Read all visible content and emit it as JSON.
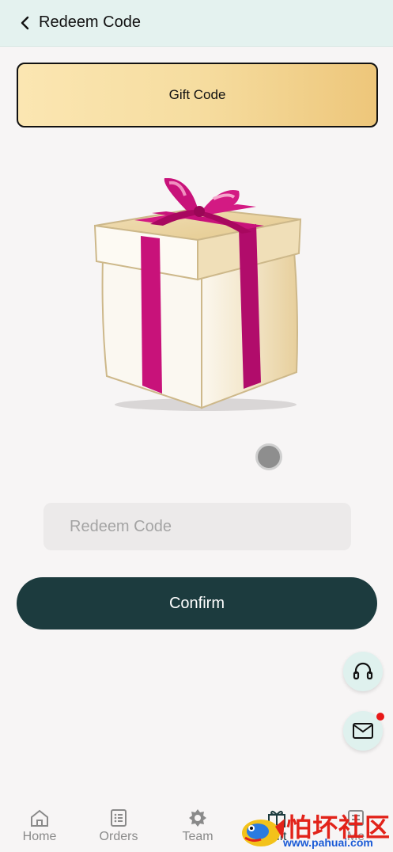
{
  "header": {
    "title": "Redeem Code"
  },
  "gift_tab": {
    "label": "Gift Code"
  },
  "redeem": {
    "placeholder": "Redeem Code",
    "confirm_label": "Confirm"
  },
  "tabbar": {
    "items": [
      {
        "label": "Home",
        "icon": "home-icon"
      },
      {
        "label": "Orders",
        "icon": "orders-icon"
      },
      {
        "label": "Team",
        "icon": "team-icon"
      },
      {
        "label": "Gift",
        "icon": "gift-icon"
      },
      {
        "label": "Me",
        "icon": "me-icon"
      }
    ]
  },
  "floating": {
    "support_icon": "headset-icon",
    "mail_icon": "mail-icon",
    "mail_badge_color": "#e81818"
  },
  "watermark": {
    "text": "怕坏社区",
    "url": "www.pahuai.com"
  },
  "colors": {
    "accent": "#1c3b3e",
    "header_bg": "#e4f2ef",
    "gift_tab_gold": "#f6dda0",
    "ribbon": "#c8127a"
  }
}
